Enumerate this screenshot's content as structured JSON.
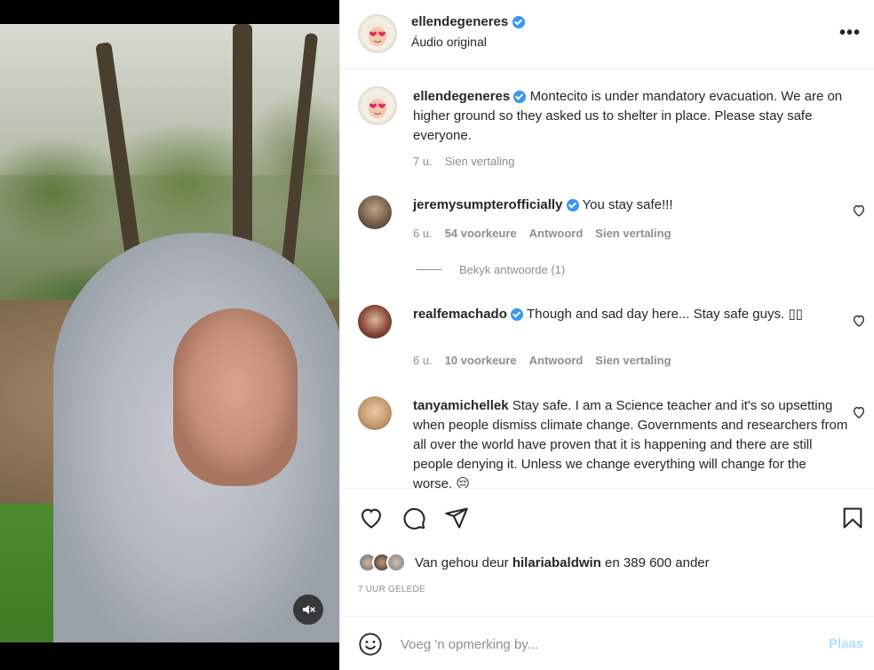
{
  "media": {
    "mute_icon": "speaker-muted-icon"
  },
  "header": {
    "username": "ellendegeneres",
    "audio_label": "Áudio original",
    "more_icon": "more-horizontal-icon",
    "more_label": "•••"
  },
  "caption": {
    "username": "ellendegeneres",
    "text": "Montecito is under mandatory evacuation. We are on higher ground so they asked us to shelter in place. Please stay safe everyone.",
    "time": "7 u.",
    "translate": "Sien vertaling"
  },
  "comments": [
    {
      "username": "jeremysumpterofficially",
      "verified": true,
      "text": "You stay safe!!!",
      "time": "6 u.",
      "likes": "54 voorkeure",
      "reply": "Antwoord",
      "translate": "Sien vertaling"
    },
    {
      "username": "realfemachado",
      "verified": true,
      "text": "Though and sad day here... Stay safe guys. ▯▯",
      "time": "6 u.",
      "likes": "10 voorkeure",
      "reply": "Antwoord",
      "translate": "Sien vertaling"
    },
    {
      "username": "tanyamichellek",
      "verified": false,
      "text": "Stay safe. I am a Science teacher and it's so upsetting when people dismiss climate change. Governments and researchers from all over the world have proven that it is happening and there are still people denying it. Unless we change everything will change for the worse. 😔"
    }
  ],
  "view_replies": "Bekyk antwoorde (1)",
  "actions": {
    "like_icon": "heart-icon",
    "comment_icon": "comment-icon",
    "share_icon": "send-icon",
    "save_icon": "bookmark-icon"
  },
  "likes": {
    "prefix": "Van gehou deur",
    "user": "hilariabaldwin",
    "suffix": "en 389 600 ander"
  },
  "timestamp": "7 UUR GELEDE",
  "add_comment": {
    "placeholder": "Voeg 'n opmerking by...",
    "post_label": "Plaas",
    "emoji_icon": "smiley-icon"
  },
  "colors": {
    "verified": "#3897f0",
    "secondary_text": "#8e8e8e",
    "post_disabled": "#b2dffc"
  }
}
